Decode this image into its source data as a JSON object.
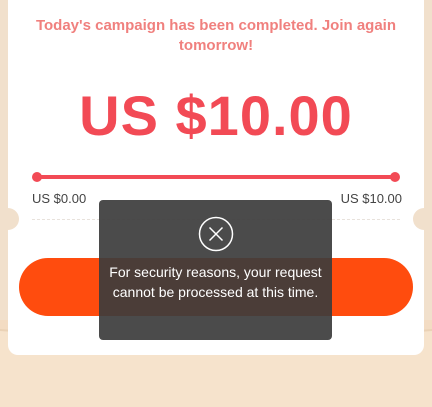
{
  "campaign": {
    "message": "Today's campaign has been completed. Join again tomorrow!",
    "amount": "US $10.00",
    "progress_value": 1.0,
    "range_min_label": "US $0.00",
    "range_max_label": "US $10.00"
  },
  "toast": {
    "icon": "close-circle-icon",
    "message": "For security reasons, your request cannot be processed at this time."
  },
  "colors": {
    "accent": "#f24a55",
    "button": "#ff4c0e",
    "message": "#f0807e",
    "toast_bg": "#3c3c3c"
  }
}
